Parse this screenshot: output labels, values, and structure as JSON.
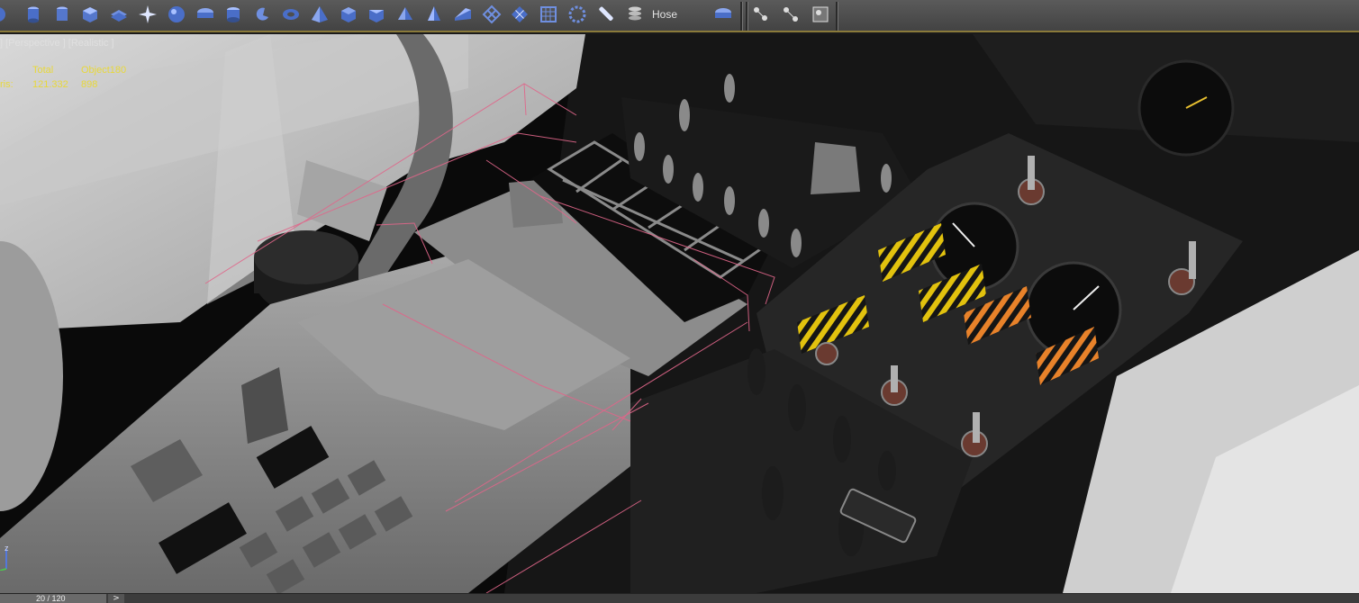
{
  "toolbar": {
    "tools": [
      {
        "icon": "sphere-half-icon"
      },
      {
        "icon": "cylinder-icon"
      },
      {
        "icon": "tube-icon"
      },
      {
        "icon": "box-icon"
      },
      {
        "icon": "plane-stack-icon"
      },
      {
        "icon": "star-icon"
      },
      {
        "icon": "geosphere-icon"
      },
      {
        "icon": "capsule-icon"
      },
      {
        "icon": "oiltank-icon"
      },
      {
        "icon": "hedra-spiral-icon"
      },
      {
        "icon": "torus-icon"
      },
      {
        "icon": "pyramid-icon"
      },
      {
        "icon": "chamfer-box-icon"
      },
      {
        "icon": "prism-icon"
      },
      {
        "icon": "gengon-icon"
      },
      {
        "icon": "cone-icon"
      },
      {
        "icon": "wedge-icon"
      },
      {
        "icon": "lattice-icon"
      },
      {
        "icon": "diamond-grid-icon"
      },
      {
        "icon": "grid-icon"
      },
      {
        "icon": "torus-knot-icon"
      },
      {
        "icon": "hose-pencil-icon"
      },
      {
        "icon": "spring-stack-icon"
      }
    ],
    "hose_label": "Hose",
    "extra_tools": [
      {
        "icon": "selection-set-icon"
      },
      {
        "icon": "mirror-icon"
      },
      {
        "icon": "scene-explorer-icon"
      }
    ]
  },
  "viewport": {
    "label": "] [Perspective ] [Realistic ]",
    "stats": {
      "col_total": "Total",
      "col_object": "Object180",
      "row_label": "ris:",
      "total_value": "121.332",
      "object_value": "898"
    },
    "axis": {
      "z": "z"
    }
  },
  "statusbar": {
    "frame": "20 / 120",
    "next": ">"
  },
  "colors": {
    "toolbar_bg": "#4e4e4e",
    "accent": "#8a7a3a",
    "stats_text": "#e8d83a",
    "wire": "#e0668a"
  }
}
